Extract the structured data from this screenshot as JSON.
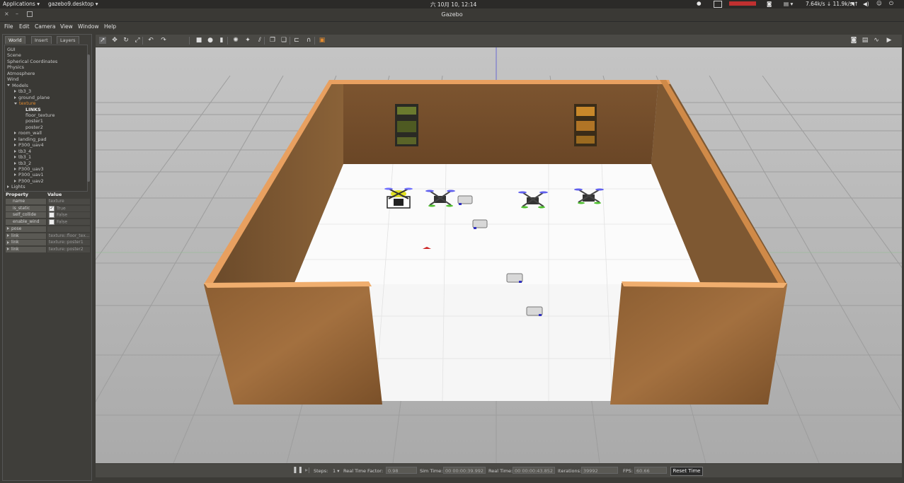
{
  "topbar": {
    "applications": "Applications ▾",
    "app_name": "gazebo9.desktop ▾",
    "clock": "六 10月 10, 12:14",
    "net_speed": "7.64k/s ↓ 11.9k/s ↑"
  },
  "window": {
    "title": "Gazebo"
  },
  "menu": [
    "File",
    "Edit",
    "Camera",
    "View",
    "Window",
    "Help"
  ],
  "left_panel": {
    "tabs": [
      "World",
      "Insert",
      "Layers"
    ],
    "tree": [
      {
        "label": "GUI",
        "indent": 0,
        "arrow": "none",
        "style": "normal"
      },
      {
        "label": "Scene",
        "indent": 0,
        "arrow": "none",
        "style": "normal"
      },
      {
        "label": "Spherical Coordinates",
        "indent": 0,
        "arrow": "none",
        "style": "normal"
      },
      {
        "label": "Physics",
        "indent": 0,
        "arrow": "none",
        "style": "normal"
      },
      {
        "label": "Atmosphere",
        "indent": 0,
        "arrow": "none",
        "style": "normal"
      },
      {
        "label": "Wind",
        "indent": 0,
        "arrow": "none",
        "style": "normal"
      },
      {
        "label": "Models",
        "indent": 0,
        "arrow": "down",
        "style": "normal"
      },
      {
        "label": "tb3_3",
        "indent": 1,
        "arrow": "right",
        "style": "normal"
      },
      {
        "label": "ground_plane",
        "indent": 1,
        "arrow": "right",
        "style": "normal"
      },
      {
        "label": "texture",
        "indent": 1,
        "arrow": "down",
        "style": "selected"
      },
      {
        "label": "LINKS",
        "indent": 2,
        "arrow": "none",
        "style": "bold"
      },
      {
        "label": "floor_texture",
        "indent": 2,
        "arrow": "none",
        "style": "normal"
      },
      {
        "label": "poster1",
        "indent": 2,
        "arrow": "none",
        "style": "normal"
      },
      {
        "label": "poster2",
        "indent": 2,
        "arrow": "none",
        "style": "normal"
      },
      {
        "label": "room_wall",
        "indent": 1,
        "arrow": "right",
        "style": "normal"
      },
      {
        "label": "landing_pad",
        "indent": 1,
        "arrow": "right",
        "style": "normal"
      },
      {
        "label": "P300_uav4",
        "indent": 1,
        "arrow": "right",
        "style": "normal"
      },
      {
        "label": "tb3_4",
        "indent": 1,
        "arrow": "right",
        "style": "normal"
      },
      {
        "label": "tb3_1",
        "indent": 1,
        "arrow": "right",
        "style": "normal"
      },
      {
        "label": "tb3_2",
        "indent": 1,
        "arrow": "right",
        "style": "normal"
      },
      {
        "label": "P300_uav3",
        "indent": 1,
        "arrow": "right",
        "style": "normal"
      },
      {
        "label": "P300_uav1",
        "indent": 1,
        "arrow": "right",
        "style": "normal"
      },
      {
        "label": "P300_uav2",
        "indent": 1,
        "arrow": "right",
        "style": "normal"
      },
      {
        "label": "Lights",
        "indent": 0,
        "arrow": "right",
        "style": "normal"
      }
    ],
    "props_header": {
      "property": "Property",
      "value": "Value"
    },
    "props": [
      {
        "key": "name",
        "value": "texture",
        "check": null
      },
      {
        "key": "is_static",
        "value": "True",
        "check": true
      },
      {
        "key": "self_collide",
        "value": "False",
        "check": false
      },
      {
        "key": "enable_wind",
        "value": "False",
        "check": false
      },
      {
        "key": "pose",
        "value": "",
        "check": null,
        "expand": true
      },
      {
        "key": "link",
        "value": "texture::floor_tex...",
        "check": null,
        "expand": true
      },
      {
        "key": "link",
        "value": "texture::poster1",
        "check": null,
        "expand": true
      },
      {
        "key": "link",
        "value": "texture::poster2",
        "check": null,
        "expand": true
      }
    ]
  },
  "toolbar": {
    "tools": [
      "select-icon",
      "translate-icon",
      "rotate-icon",
      "scale-icon",
      "undo-icon",
      "redo-icon",
      "box-icon",
      "sphere-icon",
      "cylinder-icon",
      "point-light-icon",
      "spot-light-icon",
      "directional-light-icon",
      "copy-icon",
      "paste-icon",
      "align-icon",
      "snap-icon",
      "change-view-icon"
    ],
    "right_tools": [
      "screenshot-icon",
      "log-icon",
      "plot-icon",
      "video-icon"
    ]
  },
  "bottom": {
    "steps_label": "Steps:",
    "steps_value": "1 ▾",
    "rtf_label": "Real Time Factor:",
    "rtf_value": "0.98",
    "sim_label": "Sim Time:",
    "sim_value": "00 00:00:39.992",
    "real_label": "Real Time:",
    "real_value": "00 00:00:43.852",
    "iter_label": "Iterations:",
    "iter_value": "39992",
    "fps_label": "FPS:",
    "fps_value": "60.66",
    "reset_label": "Reset Time"
  }
}
